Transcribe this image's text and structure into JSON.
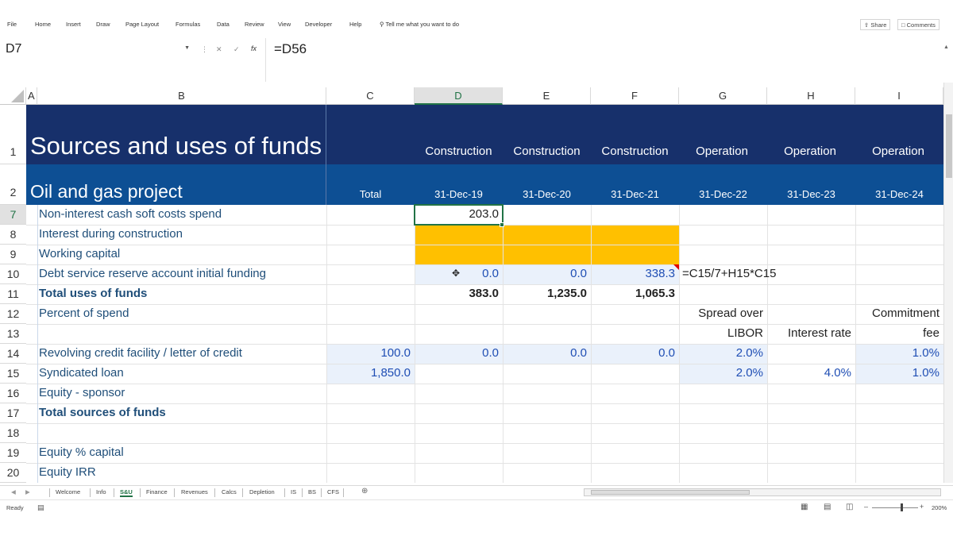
{
  "ribbon": {
    "tabs": [
      "File",
      "Home",
      "Insert",
      "Draw",
      "Page Layout",
      "Formulas",
      "Data",
      "Review",
      "View",
      "Developer",
      "Help"
    ],
    "tell_me": "Tell me what you want to do",
    "share": "Share",
    "comments": "Comments"
  },
  "formula_bar": {
    "name_box": "D7",
    "formula": "=D56",
    "cancel": "✕",
    "enter": "✓",
    "fx": "fx"
  },
  "columns": [
    "A",
    "B",
    "C",
    "D",
    "E",
    "F",
    "G",
    "H",
    "I"
  ],
  "selected_cell": "D7",
  "rows": {
    "r1": {
      "num": "1",
      "title": "Sources and uses of funds",
      "phases": [
        "Construction",
        "Construction",
        "Construction",
        "Operation",
        "Operation",
        "Operation"
      ]
    },
    "r2": {
      "num": "2",
      "subtitle": "Oil and gas project",
      "total": "Total",
      "dates": [
        "31-Dec-19",
        "31-Dec-20",
        "31-Dec-21",
        "31-Dec-22",
        "31-Dec-23",
        "31-Dec-24"
      ]
    },
    "r7": {
      "num": "7",
      "label": "Non-interest cash soft costs spend",
      "d": "203.0"
    },
    "r8": {
      "num": "8",
      "label": "Interest during construction"
    },
    "r9": {
      "num": "9",
      "label": "Working capital"
    },
    "r10": {
      "num": "10",
      "label": "Debt service reserve account initial funding",
      "d": "0.0",
      "e": "0.0",
      "f": "338.3",
      "g": "=C15/7+H15*C15"
    },
    "r11": {
      "num": "11",
      "label": "Total uses of funds",
      "d": "383.0",
      "e": "1,235.0",
      "f": "1,065.3"
    },
    "r12": {
      "num": "12",
      "label": "Percent of spend",
      "g": "Spread over",
      "i": "Commitment"
    },
    "r13": {
      "num": "13",
      "g": "LIBOR",
      "h": "Interest rate",
      "i": "fee"
    },
    "r14": {
      "num": "14",
      "label": "Revolving credit facility / letter of credit",
      "c": "100.0",
      "d": "0.0",
      "e": "0.0",
      "f": "0.0",
      "g": "2.0%",
      "i": "1.0%"
    },
    "r15": {
      "num": "15",
      "label": "Syndicated loan",
      "c": "1,850.0",
      "g": "2.0%",
      "h": "4.0%",
      "i": "1.0%"
    },
    "r16": {
      "num": "16",
      "label": "Equity - sponsor"
    },
    "r17": {
      "num": "17",
      "label": "Total sources of funds"
    },
    "r18": {
      "num": "18"
    },
    "r19": {
      "num": "19",
      "label": "Equity % capital"
    },
    "r20": {
      "num": "20",
      "label": "Equity IRR"
    }
  },
  "sheet_tabs": [
    "Welcome",
    "Info",
    "S&U",
    "Finance",
    "Revenues",
    "Calcs",
    "Depletion",
    "IS",
    "BS",
    "CFS"
  ],
  "active_sheet": "S&U",
  "status": {
    "ready": "Ready",
    "zoom": "200%"
  },
  "colors": {
    "header_dark": "#17306b",
    "header_blue": "#0d4f94",
    "label_text": "#1f4e79",
    "highlight": "#ffc000",
    "input_blue": "#1f4eb4",
    "excel_green": "#217346"
  }
}
